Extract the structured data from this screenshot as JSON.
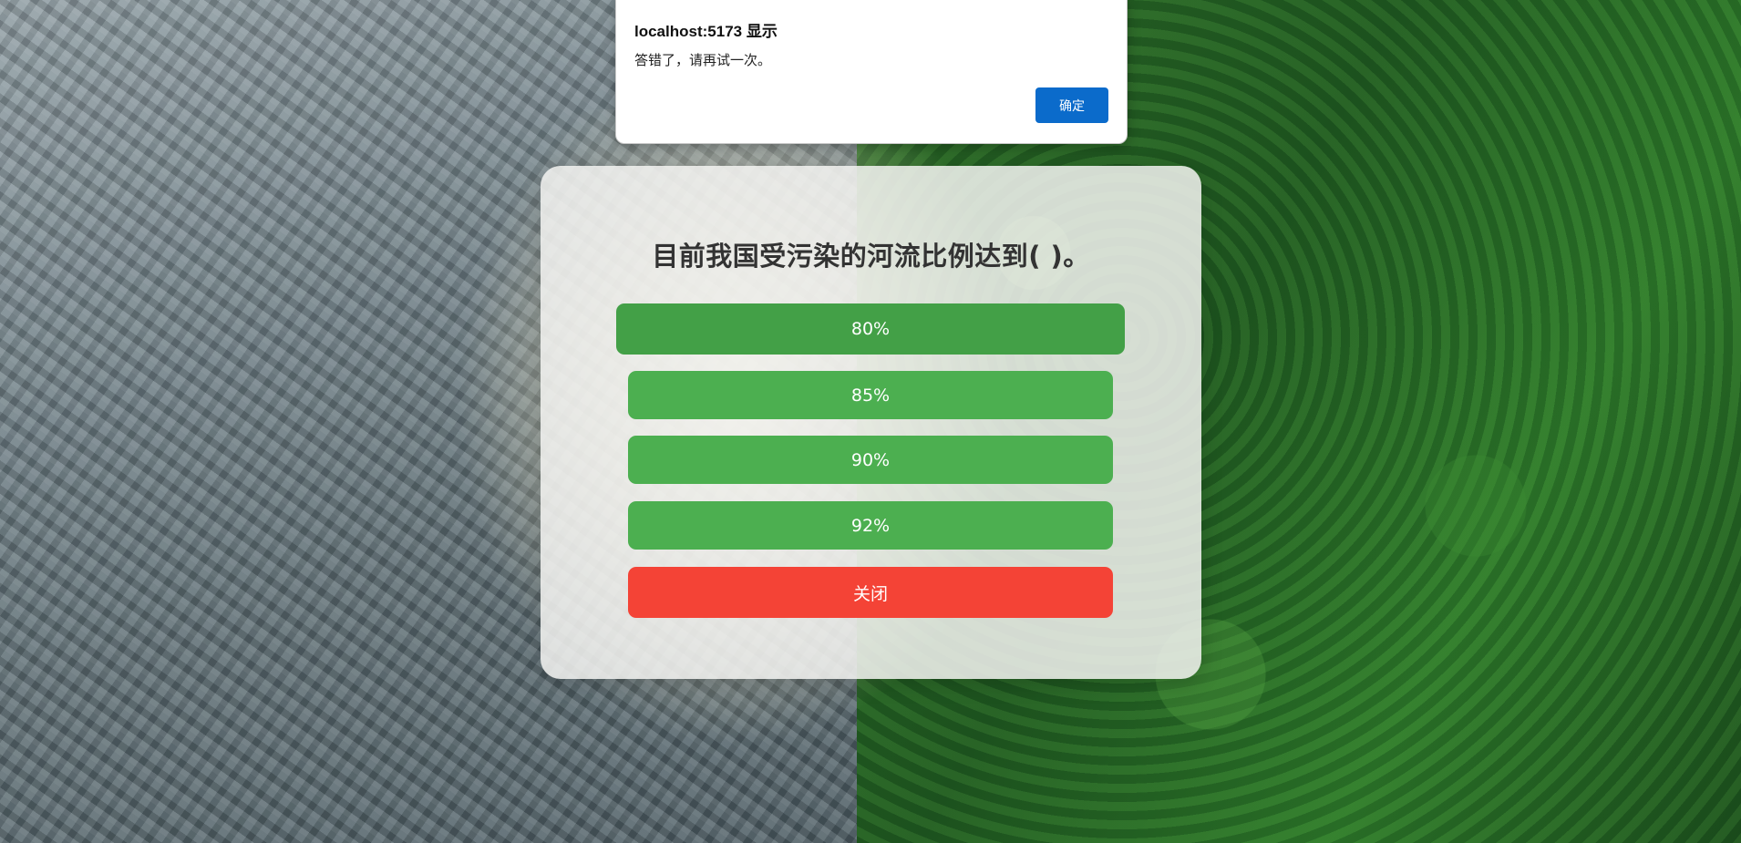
{
  "alert": {
    "title": "localhost:5173 显示",
    "message": "答错了，请再试一次。",
    "ok_label": "确定"
  },
  "quiz": {
    "question": "目前我国受污染的河流比例达到( )。",
    "options": [
      {
        "label": "80%"
      },
      {
        "label": "85%"
      },
      {
        "label": "90%"
      },
      {
        "label": "92%"
      }
    ],
    "close_label": "关闭"
  },
  "colors": {
    "option_green": "#4caf50",
    "option_hover_green": "#43a047",
    "close_red": "#f44336",
    "alert_button_blue": "#0b6bcb"
  }
}
